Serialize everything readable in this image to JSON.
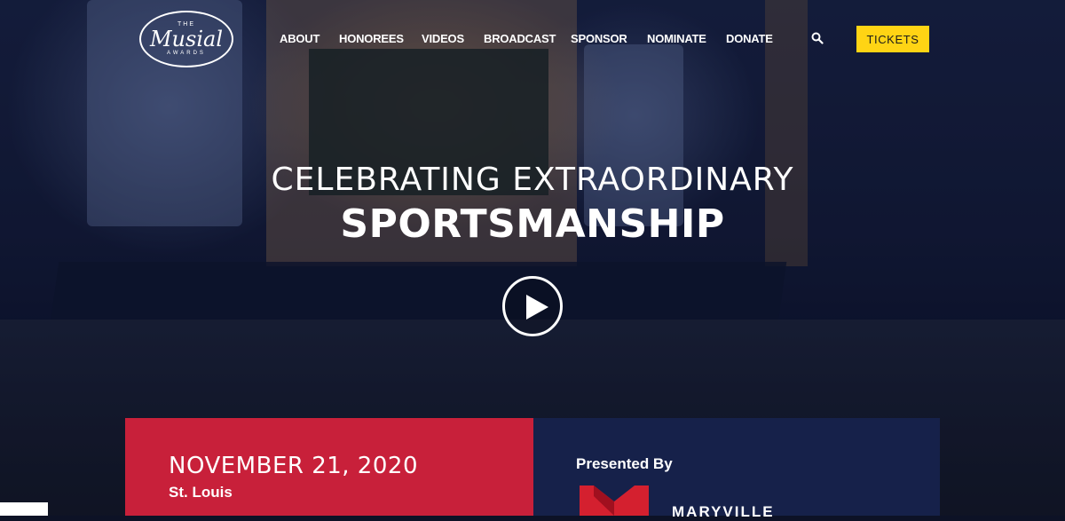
{
  "logo": {
    "top": "THE",
    "main": "Musial",
    "bottom": "AWARDS"
  },
  "nav": {
    "items": [
      {
        "label": "ABOUT"
      },
      {
        "label": "HONOREES"
      },
      {
        "label": "VIDEOS"
      },
      {
        "label": "BROADCAST"
      },
      {
        "label": "SPONSOR"
      },
      {
        "label": "NOMINATE"
      },
      {
        "label": "DONATE"
      }
    ],
    "search_icon": "search-icon",
    "tickets_label": "TICKETS"
  },
  "hero": {
    "line1": "CELEBRATING EXTRAORDINARY",
    "line2": "SPORTSMANSHIP",
    "play_icon": "play-icon"
  },
  "event": {
    "date": "NOVEMBER 21, 2020",
    "city": "St. Louis"
  },
  "presented": {
    "label": "Presented By",
    "sponsor_name": "MARYVILLE"
  },
  "colors": {
    "tickets_bg": "#ffd414",
    "date_panel": "#c8203a",
    "presented_panel": "#16214a",
    "sponsor_red": "#d4202f"
  }
}
